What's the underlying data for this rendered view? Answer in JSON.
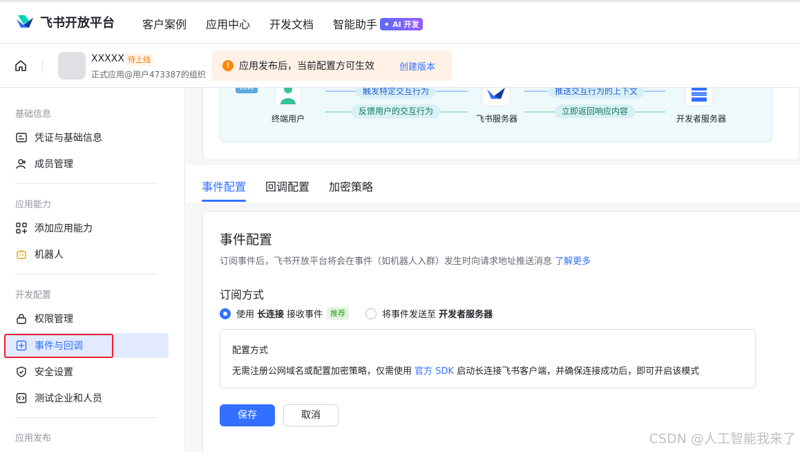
{
  "brand": {
    "name": "飞书开放平台"
  },
  "nav": {
    "items": [
      "客户案例",
      "应用中心",
      "开发文档",
      "智能助手"
    ],
    "ai_badge": "✦ AI 开发"
  },
  "app": {
    "name": "XXXXX",
    "status": "待上线",
    "subtitle": "正式应用@用户473387的组织",
    "notice": "应用发布后，当前配置方可生效",
    "notice_action": "创建版本",
    "notice_icon": "!"
  },
  "sidebar": {
    "groups": {
      "basic": "基础信息",
      "ability": "应用能力",
      "dev": "开发配置",
      "publish": "应用发布"
    },
    "items": {
      "credentials": "凭证与基础信息",
      "members": "成员管理",
      "add_ability": "添加应用能力",
      "bot": "机器人",
      "permissions": "权限管理",
      "events": "事件与回调",
      "security": "安全设置",
      "testing": "测试企业和人员"
    }
  },
  "flow": {
    "callback_tag": "回调",
    "end_user": "终端用户",
    "feishu_server": "飞书服务器",
    "dev_server": "开发者服务器",
    "chip_trigger": "触发特定交互行为",
    "chip_feedback": "反馈用户的交互行为",
    "chip_push": "推送交互行为的上下文",
    "chip_return": "立即返回响应内容"
  },
  "tabs": [
    "事件配置",
    "回调配置",
    "加密策略"
  ],
  "event_config": {
    "title": "事件配置",
    "desc": "订阅事件后，飞书开放平台将会在事件（如机器人入群）发生时向请求地址推送消息",
    "learn_more": "了解更多",
    "subscribe_title": "订阅方式",
    "option1_pre": "使用",
    "option1_bold": "长连接",
    "option1_post": "接收事件",
    "recommend": "推荐",
    "option2_pre": "将事件发送至",
    "option2_bold": "开发者服务器",
    "mode_title": "配置方式",
    "mode_desc_pre": "无需注册公网域名或配置加密策略，仅需使用",
    "mode_desc_link": "官方 SDK",
    "mode_desc_post": "启动长连接飞书客户端，并确保连接成功后，即可开启该模式",
    "save": "保存",
    "cancel": "取消"
  },
  "watermark": "CSDN @人工智能我来了",
  "colors": {
    "accent": "#3370ff",
    "highlight_border": "#e8202a"
  }
}
